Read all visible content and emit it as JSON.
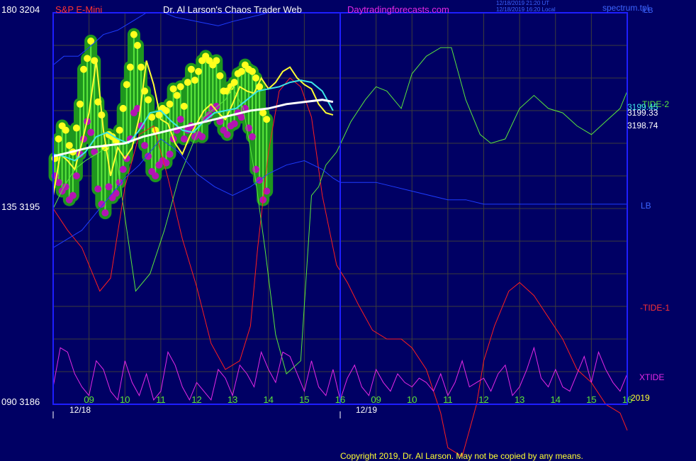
{
  "header": {
    "instrument": "S&P E-Mini",
    "title": "Dr. Al Larson's Chaos Trader Web",
    "site": "Daytradingforecasts.com",
    "timestamp_line1": "12/18/2019 21:20 UT",
    "timestamp_line2": "12/18/2019 16:20 Local",
    "file": "spectrum.tpl"
  },
  "left_axis": {
    "top": "180  3204",
    "mid": "135  3195",
    "bottom": "090  3186"
  },
  "right_labels": {
    "tide2": "-TIDE-2",
    "lb_top": "LB",
    "lb_mid": "LB",
    "tide1": "-TIDE-1",
    "xtide": "XTIDE",
    "year": "2019",
    "price_a": "3199.45",
    "price_b": "3199.33",
    "price_c": "3198.74"
  },
  "footer": {
    "copyright": "Copyright 2019, Dr. Al Larson. May not be copied by any means."
  },
  "colors": {
    "background": "#000064",
    "grid": "#3c3c3c",
    "frame": "#1e1eff",
    "red_line": "#ff1e1e",
    "green_line": "#5ae63c",
    "blue_line": "#1e3cff",
    "magenta_line": "#e628e6",
    "fast_avg": "#ffff32",
    "mid_avg": "#3ce6e6",
    "slow_avg": "#ffffff",
    "halo": "#1e961e",
    "highs": "#ffff1e",
    "lows": "#b414b4"
  },
  "chart_data": {
    "type": "line",
    "title": "",
    "y_axis": {
      "price_range": [
        3186,
        3204
      ],
      "tide_range": [
        90,
        180
      ],
      "ticks": [
        3186,
        3195,
        3204
      ]
    },
    "x_axis": {
      "hour_ticks": [
        "09",
        "10",
        "11",
        "12",
        "13",
        "14",
        "15",
        "16",
        "09",
        "10",
        "11",
        "12",
        "13",
        "14",
        "15",
        "16"
      ],
      "date_labels": [
        "12/18",
        "12/19"
      ],
      "range": [
        0,
        16
      ]
    },
    "grid": true,
    "series": [
      {
        "name": "-TIDE-1",
        "color_key": "red_line",
        "x": [
          0,
          0.4,
          0.8,
          1,
          1.3,
          1.6,
          2,
          2.4,
          2.8,
          3.2,
          3.6,
          4,
          4.4,
          4.8,
          5.2,
          5.5,
          5.7,
          6,
          6.3,
          6.6,
          6.9,
          7.2,
          7.5,
          7.9,
          8.2,
          8.5,
          8.9,
          9.3,
          9.7,
          10,
          10.4,
          10.8,
          11,
          11.4,
          11.8,
          12,
          12.3,
          12.7,
          13,
          13.4,
          13.8,
          14.2,
          14.6,
          15,
          15.4,
          15.8,
          16
        ],
        "values": [
          135,
          130,
          126,
          122,
          116,
          119,
          140,
          152,
          154,
          142,
          128,
          117,
          104,
          98,
          100,
          108,
          126,
          148,
          162,
          165,
          163,
          156,
          138,
          122,
          118,
          113,
          107,
          105,
          105,
          103,
          98,
          88,
          80,
          78,
          90,
          100,
          108,
          116,
          118,
          115,
          110,
          105,
          98,
          95,
          90,
          88,
          84
        ]
      },
      {
        "name": "-TIDE-2",
        "color_key": "green_line",
        "x": [
          0,
          0.3,
          0.6,
          0.9,
          1.3,
          1.7,
          2,
          2.3,
          2.7,
          3.1,
          3.5,
          3.9,
          4.2,
          4.5,
          4.8,
          5,
          5.3,
          5.6,
          5.9,
          6.2,
          6.5,
          6.9,
          7.2,
          7.4,
          7.6,
          7.9,
          8.3,
          8.7,
          9,
          9.3,
          9.7,
          10,
          10.4,
          10.8,
          11.1,
          11.5,
          11.9,
          12.2,
          12.6,
          13,
          13.4,
          13.8,
          14.2,
          14.6,
          15,
          15.4,
          15.8,
          16
        ],
        "values": [
          135,
          140,
          144,
          146,
          148,
          150,
          133,
          116,
          120,
          130,
          142,
          150,
          156,
          158,
          160,
          163,
          158,
          144,
          126,
          106,
          97,
          100,
          138,
          140,
          145,
          148,
          155,
          160,
          163,
          162,
          158,
          166,
          170,
          172,
          172,
          160,
          152,
          150,
          151,
          158,
          161,
          158,
          157,
          154,
          152,
          155,
          158,
          162
        ]
      },
      {
        "name": "LB",
        "color_key": "blue_line",
        "x": [
          0,
          0.4,
          0.8,
          1.2,
          1.7,
          2,
          2.4,
          2.7,
          3,
          3.5,
          4,
          4.5,
          5,
          5.5,
          6,
          6.5,
          7,
          7.5,
          7.8,
          8,
          8.5,
          9,
          9.5,
          10,
          10.5,
          11,
          11.5,
          12,
          12.5,
          13,
          13.5,
          14,
          14.5,
          15,
          15.5,
          16
        ],
        "values": [
          126,
          128,
          130,
          134,
          139,
          142,
          145,
          148,
          151,
          148,
          143,
          140,
          138,
          140,
          143,
          145,
          146,
          144,
          142,
          141,
          141,
          141,
          140,
          139,
          138,
          137,
          137,
          136,
          136,
          136,
          136,
          136,
          136,
          136,
          136,
          136
        ]
      },
      {
        "name": "LB-upper",
        "color_key": "blue_line",
        "x": [
          0,
          0.3,
          0.7,
          1,
          1.4,
          1.8,
          2.2,
          2.6,
          2.9,
          3.1,
          3.4,
          4,
          4.6,
          5,
          5.5,
          6,
          6.5,
          6.8,
          7.2,
          7.6,
          7.9,
          8
        ],
        "values": [
          168,
          170,
          170,
          172,
          175,
          176,
          178,
          180,
          180,
          180,
          179,
          178,
          177,
          178,
          179,
          180,
          180,
          180,
          180,
          180,
          180,
          180
        ]
      },
      {
        "name": "XTIDE",
        "color_key": "magenta_line",
        "x": [
          0,
          0.2,
          0.4,
          0.6,
          0.8,
          1,
          1.2,
          1.4,
          1.6,
          1.8,
          2,
          2.2,
          2.4,
          2.6,
          2.8,
          3,
          3.2,
          3.4,
          3.6,
          3.8,
          4,
          4.2,
          4.4,
          4.6,
          4.8,
          5,
          5.2,
          5.4,
          5.6,
          5.8,
          6,
          6.2,
          6.4,
          6.6,
          6.8,
          7,
          7.2,
          7.4,
          7.6,
          7.8,
          8,
          8.2,
          8.4,
          8.6,
          8.8,
          9,
          9.2,
          9.4,
          9.6,
          9.8,
          10,
          10.2,
          10.4,
          10.6,
          10.8,
          11,
          11.2,
          11.4,
          11.6,
          11.8,
          12,
          12.2,
          12.4,
          12.6,
          12.8,
          13,
          13.2,
          13.4,
          13.6,
          13.8,
          14,
          14.2,
          14.4,
          14.6,
          14.8,
          15,
          15.2,
          15.4,
          15.6,
          15.8,
          16
        ],
        "values": [
          94,
          103,
          102,
          97,
          94,
          92,
          100,
          98,
          93,
          91,
          100,
          95,
          92,
          97,
          91,
          93,
          102,
          99,
          94,
          91,
          95,
          93,
          91,
          98,
          96,
          92,
          99,
          97,
          94,
          102,
          98,
          95,
          102,
          101,
          97,
          93,
          100,
          94,
          92,
          98,
          91,
          96,
          99,
          94,
          92,
          98,
          95,
          93,
          97,
          95,
          94,
          96,
          95,
          93,
          97,
          92,
          95,
          100,
          94,
          95,
          96,
          93,
          97,
          99,
          92,
          94,
          98,
          103,
          96,
          94,
          98,
          94,
          93,
          97,
          101,
          95,
          102,
          98,
          95,
          93,
          97
        ]
      },
      {
        "name": "fast-average",
        "color_key": "fast_avg",
        "x": [
          0,
          0.2,
          0.4,
          0.6,
          0.8,
          1,
          1.2,
          1.4,
          1.6,
          1.8,
          2,
          2.2,
          2.4,
          2.6,
          2.8,
          3,
          3.2,
          3.4,
          3.6,
          3.8,
          4,
          4.2,
          4.4,
          4.6,
          4.8,
          5,
          5.2,
          5.4,
          5.6,
          5.8,
          6,
          6.2,
          6.4,
          6.6,
          6.8,
          7,
          7.2,
          7.4,
          7.6,
          7.8
        ],
        "values": [
          3195.6,
          3197.5,
          3197.2,
          3196.8,
          3198.0,
          3199.4,
          3201.8,
          3198.6,
          3196.5,
          3197.8,
          3197.3,
          3197.8,
          3199.2,
          3201.8,
          3200.7,
          3199.1,
          3198.9,
          3198.0,
          3197.5,
          3198.3,
          3198.9,
          3199.5,
          3199.8,
          3199.4,
          3199.1,
          3199.8,
          3200.6,
          3200.4,
          3200.3,
          3201.0,
          3200.5,
          3200.8,
          3201.3,
          3201.5,
          3201.0,
          3200.7,
          3200.5,
          3199.8,
          3199.4,
          3199.3
        ]
      },
      {
        "name": "mid-average",
        "color_key": "mid_avg",
        "x": [
          0,
          0.3,
          0.6,
          0.9,
          1.2,
          1.5,
          1.8,
          2.1,
          2.4,
          2.7,
          3,
          3.3,
          3.6,
          3.9,
          4.2,
          4.5,
          4.8,
          5.1,
          5.4,
          5.7,
          6,
          6.3,
          6.6,
          6.9,
          7.2,
          7.5,
          7.8
        ],
        "values": [
          3197.5,
          3197.4,
          3197.2,
          3197.6,
          3198.3,
          3198.5,
          3198.2,
          3198.0,
          3198.6,
          3199.4,
          3199.5,
          3199.0,
          3198.6,
          3198.5,
          3199.0,
          3199.4,
          3199.5,
          3199.6,
          3200.0,
          3200.4,
          3200.5,
          3200.6,
          3200.8,
          3200.9,
          3200.8,
          3200.4,
          3199.5
        ]
      },
      {
        "name": "slow-average",
        "color_key": "slow_avg",
        "x": [
          0,
          0.5,
          1,
          1.5,
          2,
          2.5,
          3,
          3.5,
          4,
          4.5,
          5,
          5.5,
          6,
          6.5,
          7,
          7.5,
          7.8
        ],
        "values": [
          3197.4,
          3197.6,
          3197.8,
          3197.9,
          3198.0,
          3198.3,
          3198.5,
          3198.7,
          3198.9,
          3199.1,
          3199.3,
          3199.5,
          3199.6,
          3199.8,
          3199.9,
          3200.0,
          3199.9
        ]
      }
    ],
    "bars": {
      "x": [
        0.05,
        0.15,
        0.25,
        0.35,
        0.45,
        0.55,
        0.65,
        0.75,
        0.85,
        0.95,
        1.05,
        1.15,
        1.25,
        1.35,
        1.45,
        1.55,
        1.65,
        1.75,
        1.85,
        1.95,
        2.05,
        2.15,
        2.25,
        2.35,
        2.45,
        2.55,
        2.65,
        2.75,
        2.85,
        2.95,
        3.05,
        3.15,
        3.25,
        3.35,
        3.45,
        3.55,
        3.65,
        3.75,
        3.85,
        3.95,
        4.05,
        4.15,
        4.25,
        4.35,
        4.45,
        4.55,
        4.65,
        4.75,
        4.85,
        4.95,
        5.05,
        5.15,
        5.25,
        5.35,
        5.45,
        5.55,
        5.65,
        5.75,
        5.85,
        5.95,
        6.05,
        6.15,
        6.25,
        6.35,
        6.45,
        6.55,
        6.65,
        6.75,
        6.85,
        6.95,
        7.05,
        7.15,
        7.25,
        7.35,
        7.45,
        7.55,
        7.65,
        7.75
      ],
      "high": [
        3197.3,
        3198.2,
        3198.8,
        3198.6,
        3197.9,
        3197.6,
        3198.7,
        3199.8,
        3201.4,
        3201.9,
        3202.7,
        3201.8,
        3199.9,
        3199.3,
        3197.8,
        3198.4,
        3198.3,
        3198.1,
        3198.6,
        3199.6,
        3200.7,
        3201.5,
        3203.0,
        3202.5,
        3201.5,
        3200.4,
        3200.0,
        3199.2,
        3198.6,
        3199.3,
        3199.6,
        3199.5,
        3199.8,
        3200.5,
        3200.2,
        3200.6,
        3199.7,
        3200.8,
        3201.4,
        3200.9,
        3201.3,
        3201.8,
        3202.0,
        3201.8,
        3201.6,
        3201.8,
        3201.1,
        3200.4,
        3200.4,
        3200.6,
        3200.8,
        3201.2,
        3201.3,
        3201.6,
        3201.4,
        3201.3,
        3201.0,
        3200.6,
        3199.4,
        3199.1
      ],
      "low": [
        3196.5,
        3196.2,
        3195.8,
        3196.0,
        3195.4,
        3195.6,
        3196.5,
        3197.5,
        3198.2,
        3199.0,
        3198.5,
        3197.6,
        3195.9,
        3195.2,
        3194.8,
        3196.0,
        3195.5,
        3195.7,
        3196.2,
        3196.8,
        3197.3,
        3198.2,
        3199.4,
        3199.6,
        3198.8,
        3197.9,
        3197.4,
        3196.7,
        3196.5,
        3197.0,
        3197.2,
        3197.1,
        3197.5,
        3198.2,
        3198.6,
        3199.1,
        3198.2,
        3198.6,
        3198.8,
        3198.3,
        3198.4,
        3198.3,
        3199.1,
        3199.3,
        3199.6,
        3199.7,
        3199.0,
        3198.6,
        3198.4,
        3198.8,
        3198.9,
        3199.4,
        3199.2,
        3199.6,
        3198.7,
        3198.3,
        3196.8,
        3196.3,
        3195.4,
        3195.8
      ]
    },
    "right_labels_values": [
      3199.45,
      3199.33,
      3198.74
    ]
  }
}
